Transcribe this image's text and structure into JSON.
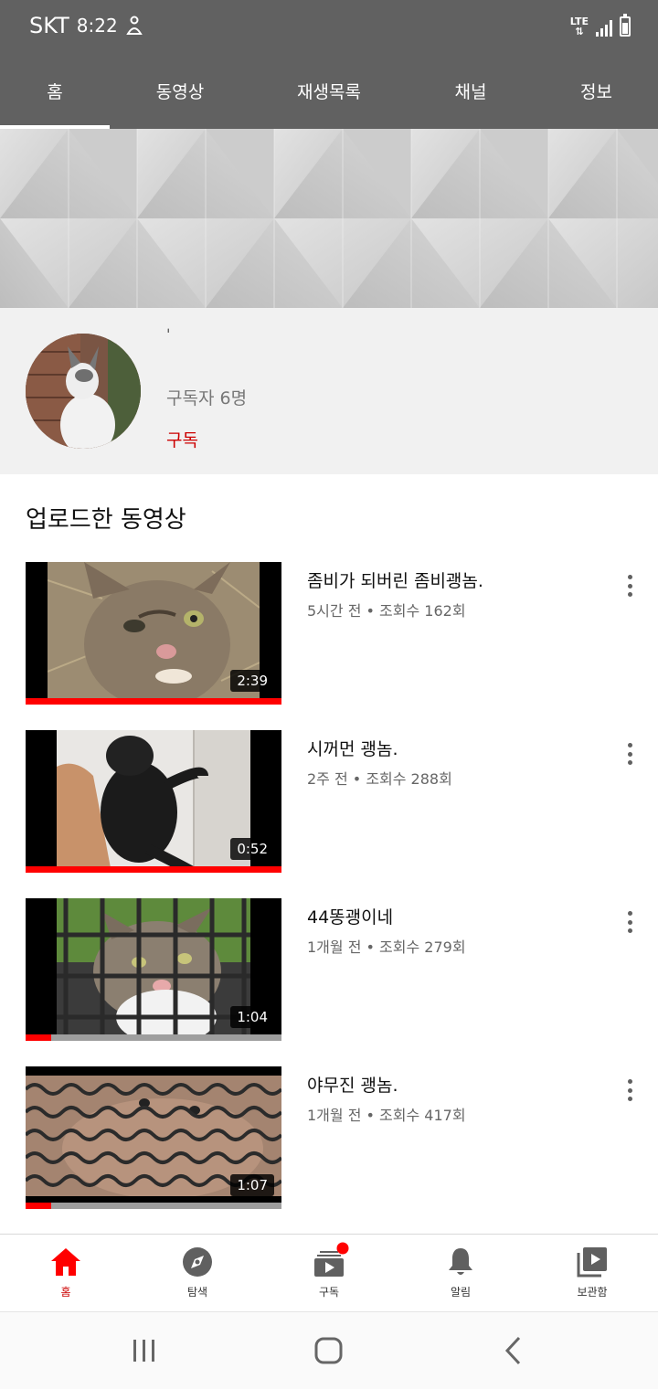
{
  "status_bar": {
    "carrier": "SKT",
    "time": "8:22",
    "network": "LTE"
  },
  "tabs": [
    {
      "label": "홈",
      "active": true
    },
    {
      "label": "동영상",
      "active": false
    },
    {
      "label": "재생목록",
      "active": false
    },
    {
      "label": "채널",
      "active": false
    },
    {
      "label": "정보",
      "active": false
    }
  ],
  "channel": {
    "name": "ˈ",
    "subscribers": "구독자 6명",
    "subscribe_label": "구독"
  },
  "uploads": {
    "section_title": "업로드한 동영상",
    "videos": [
      {
        "title": "좀비가 되버린 좀비괭놈.",
        "meta": "5시간 전 • 조회수 162회",
        "duration": "2:39",
        "watched_progress": 1.0
      },
      {
        "title": "시꺼먼 괭놈.",
        "meta": "2주 전 • 조회수 288회",
        "duration": "0:52",
        "watched_progress": 1.0
      },
      {
        "title": "44똥괭이네",
        "meta": "1개월 전 • 조회수 279회",
        "duration": "1:04",
        "watched_progress": 0.1
      },
      {
        "title": "야무진 괭놈.",
        "meta": "1개월 전 • 조회수 417회",
        "duration": "1:07",
        "watched_progress": 0.1
      }
    ]
  },
  "bottom_nav": [
    {
      "label": "홈",
      "icon": "home-icon",
      "active": true
    },
    {
      "label": "탐색",
      "icon": "compass-icon",
      "active": false
    },
    {
      "label": "구독",
      "icon": "subscriptions-icon",
      "active": false,
      "badge": true
    },
    {
      "label": "알림",
      "icon": "bell-icon",
      "active": false
    },
    {
      "label": "보관함",
      "icon": "library-icon",
      "active": false
    }
  ],
  "colors": {
    "header": "#616161",
    "accent": "#cc0000",
    "progress": "#ff0000"
  }
}
